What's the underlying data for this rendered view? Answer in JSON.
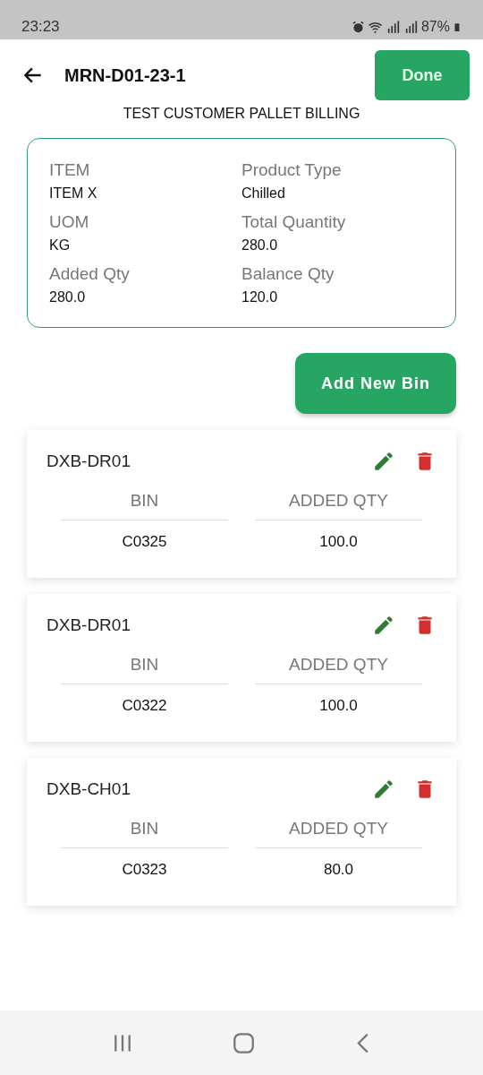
{
  "status_bar": {
    "time": "23:23",
    "battery": "87%"
  },
  "app_bar": {
    "title": "MRN-D01-23-1",
    "action": "Done"
  },
  "subtitle": "TEST CUSTOMER PALLET BILLING",
  "summary": [
    {
      "label": "ITEM",
      "value": "ITEM X"
    },
    {
      "label": "Product Type",
      "value": "Chilled"
    },
    {
      "label": "UOM",
      "value": "KG"
    },
    {
      "label": "Total Quantity",
      "value": "280.0"
    },
    {
      "label": "Added Qty",
      "value": "280.0"
    },
    {
      "label": "Balance Qty",
      "value": "120.0"
    }
  ],
  "add_button": "Add New Bin",
  "bins": [
    {
      "location": "DXB-DR01",
      "columns": [
        "BIN",
        "ADDED QTY"
      ],
      "values": [
        "C0325",
        "100.0"
      ]
    },
    {
      "location": "DXB-DR01",
      "columns": [
        "BIN",
        "ADDED QTY"
      ],
      "values": [
        "C0322",
        "100.0"
      ]
    },
    {
      "location": "DXB-CH01",
      "columns": [
        "BIN",
        "ADDED QTY"
      ],
      "values": [
        "C0323",
        "80.0"
      ]
    }
  ]
}
